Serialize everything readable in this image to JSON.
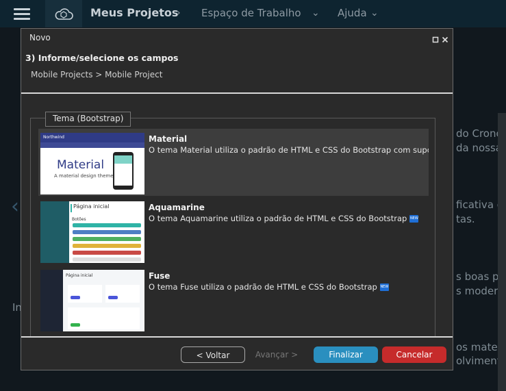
{
  "topbar": {
    "title": "Meus Projetos",
    "nav": [
      "Espaço de Trabalho",
      "Ajuda"
    ]
  },
  "background": {
    "lines": [
      "do Crono",
      "da nossa",
      "ficativa d",
      "tas.",
      "s boas pr",
      "s moderno",
      "os materi",
      "olvimento.",
      "In"
    ]
  },
  "modal": {
    "title": "Novo",
    "step": "3) Informe/selecione os campos",
    "breadcrumb": "Mobile Projects > Mobile Project",
    "group_label": "Tema (Bootstrap)",
    "themes": [
      {
        "name": "Material",
        "description": "O tema Material utiliza o padrão de HTML e CSS do Bootstrap com suporte",
        "selected": true,
        "is_new": false,
        "thumb": {
          "header": "Northwind",
          "big": "Material",
          "small": "A material design theme"
        }
      },
      {
        "name": "Aquamarine",
        "description": "O tema Aquamarine utiliza o padrão de HTML e CSS do Bootstrap",
        "selected": false,
        "is_new": true,
        "thumb": {
          "heading": "Página inicial",
          "sub": "Botões"
        }
      },
      {
        "name": "Fuse",
        "description": "O tema Fuse utiliza o padrão de HTML e CSS do Bootstrap",
        "selected": false,
        "is_new": true,
        "thumb": {
          "heading": "Página inicial"
        }
      }
    ],
    "buttons": {
      "back": "< Voltar",
      "next": "Avançar >",
      "finish": "Finalizar",
      "cancel": "Cancelar"
    }
  },
  "colors": {
    "finish": "#2a8fbf",
    "cancel": "#c62b2b",
    "topbar": "#0e2430"
  }
}
